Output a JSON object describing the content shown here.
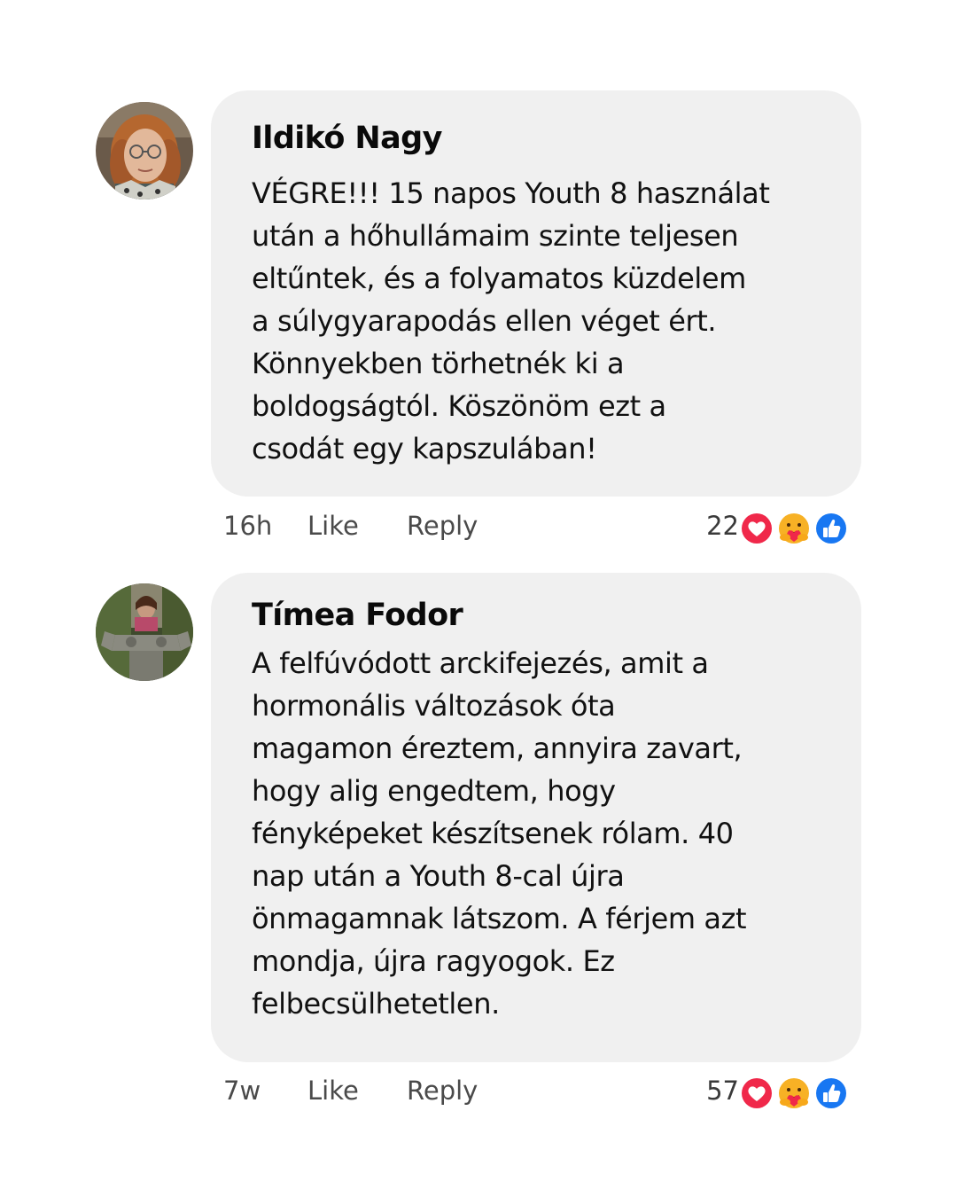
{
  "comments": [
    {
      "author": "Ildikó Nagy",
      "text": "VÉGRE!!! 15 napos Youth 8 használat\nután a hőhullámaim szinte teljesen\neltűntek, és a folyamatos küzdelem\na súlygyarapodás ellen véget ért.\nKönnyekben törhetnék ki a\nboldogságtól. Köszönöm ezt a\ncsodát egy kapszulában!",
      "time": "16h",
      "like_label": "Like",
      "reply_label": "Reply",
      "reaction_count": "22",
      "reactions": [
        "heart-icon",
        "care-icon",
        "thumbs-up-icon"
      ]
    },
    {
      "author": "Tímea Fodor",
      "text": "A felfúvódott arckifejezés, amit a\nhormonális változások óta\nmagamon éreztem, annyira zavart,\nhogy alig engedtem, hogy\nfényképeket készítsenek rólam. 40\nnap után a Youth 8-cal újra\nönmagamnak látszom. A férjem azt\nmondja, újra ragyogok. Ez\nfelbecsülhetetlen.",
      "time": "7w",
      "like_label": "Like",
      "reply_label": "Reply",
      "reaction_count": "57",
      "reactions": [
        "heart-icon",
        "care-icon",
        "thumbs-up-icon"
      ]
    }
  ],
  "colors": {
    "bubble": "#f0f0f0",
    "heart": "#f0284a",
    "care": "#f7b125",
    "like": "#1877f2"
  }
}
